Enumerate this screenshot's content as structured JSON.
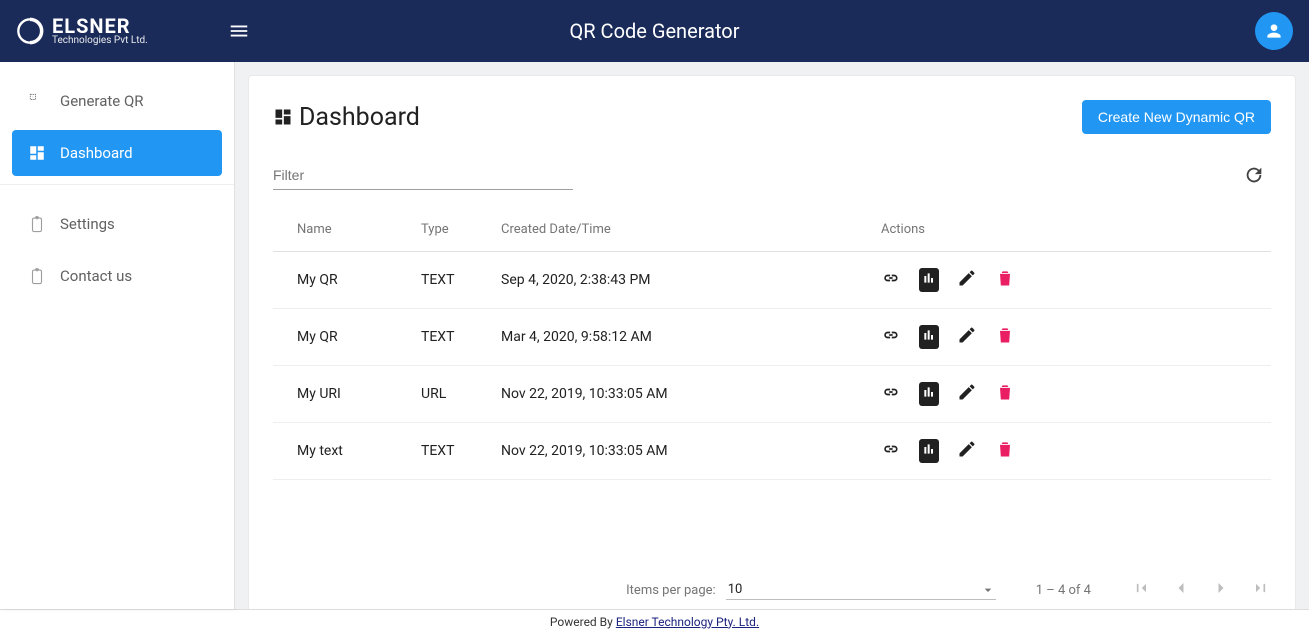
{
  "header": {
    "logo_main": "ELSNER",
    "logo_sub": "Technologies Pvt Ltd.",
    "app_title": "QR Code Generator"
  },
  "sidebar": {
    "items": [
      {
        "label": "Generate QR"
      },
      {
        "label": "Dashboard"
      },
      {
        "label": "Settings"
      },
      {
        "label": "Contact us"
      }
    ]
  },
  "dashboard": {
    "title": "Dashboard",
    "create_btn": "Create New Dynamic QR",
    "filter_placeholder": "Filter",
    "columns": {
      "name": "Name",
      "type": "Type",
      "date": "Created Date/Time",
      "actions": "Actions"
    },
    "rows": [
      {
        "name": "My QR",
        "type": "TEXT",
        "date": "Sep 4, 2020, 2:38:43 PM"
      },
      {
        "name": "My QR",
        "type": "TEXT",
        "date": "Mar 4, 2020, 9:58:12 AM"
      },
      {
        "name": "My URI",
        "type": "URL",
        "date": "Nov 22, 2019, 10:33:05 AM"
      },
      {
        "name": "My text",
        "type": "TEXT",
        "date": "Nov 22, 2019, 10:33:05 AM"
      }
    ],
    "paginator": {
      "items_per_page_label": "Items per page:",
      "items_per_page_value": "10",
      "range_label": "1 – 4 of 4"
    }
  },
  "footer": {
    "prefix": "Powered By",
    "link": "Elsner Technology Pty. Ltd."
  }
}
